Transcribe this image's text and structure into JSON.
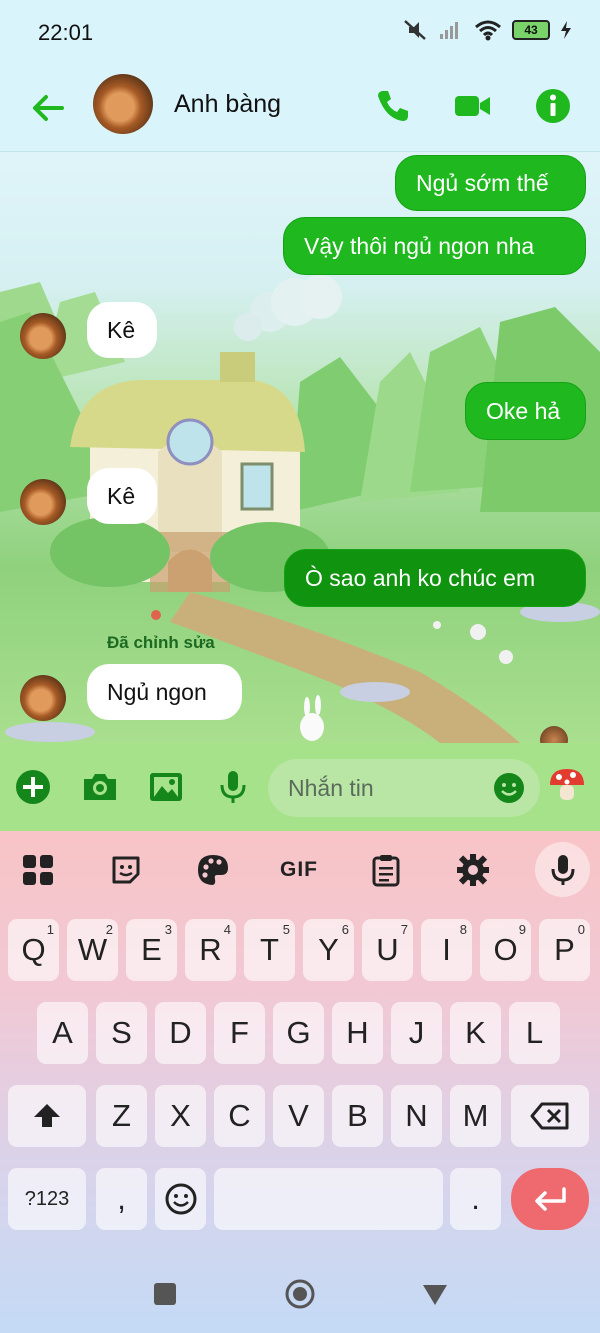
{
  "status": {
    "time": "22:01",
    "battery": "43"
  },
  "header": {
    "contact_name": "Anh bàng"
  },
  "messages": [
    {
      "dir": "out",
      "text": "Ngủ sớm thế"
    },
    {
      "dir": "out",
      "text": "Vậy thôi ngủ ngon nha"
    },
    {
      "dir": "in",
      "text": "Kê"
    },
    {
      "dir": "out",
      "text": "Oke hả"
    },
    {
      "dir": "in",
      "text": "Kê"
    },
    {
      "dir": "out",
      "text": "Ò sao anh ko chúc em"
    },
    {
      "dir": "in",
      "text": "Ngủ ngon"
    }
  ],
  "edited_label": "Đã chỉnh sửa",
  "composer": {
    "placeholder": "Nhắn tin"
  },
  "keyboard": {
    "toolbar": [
      "apps-icon",
      "sticker-icon",
      "theme-palette-icon",
      "GIF",
      "clipboard-icon",
      "settings-icon",
      "voice-mic-icon"
    ],
    "gif_label": "GIF",
    "row1": [
      {
        "k": "Q",
        "n": "1"
      },
      {
        "k": "W",
        "n": "2"
      },
      {
        "k": "E",
        "n": "3"
      },
      {
        "k": "R",
        "n": "4"
      },
      {
        "k": "T",
        "n": "5"
      },
      {
        "k": "Y",
        "n": "6"
      },
      {
        "k": "U",
        "n": "7"
      },
      {
        "k": "I",
        "n": "8"
      },
      {
        "k": "O",
        "n": "9"
      },
      {
        "k": "P",
        "n": "0"
      }
    ],
    "row2": [
      "A",
      "S",
      "D",
      "F",
      "G",
      "H",
      "J",
      "K",
      "L"
    ],
    "row3": [
      "Z",
      "X",
      "C",
      "V",
      "B",
      "N",
      "M"
    ],
    "bottom": {
      "symbols": "?123",
      "comma": ",",
      "period": "."
    }
  },
  "colors": {
    "accent": "#1fb81f",
    "bubble_out": "#1fb81f",
    "enter_key": "#ee6a6f"
  }
}
